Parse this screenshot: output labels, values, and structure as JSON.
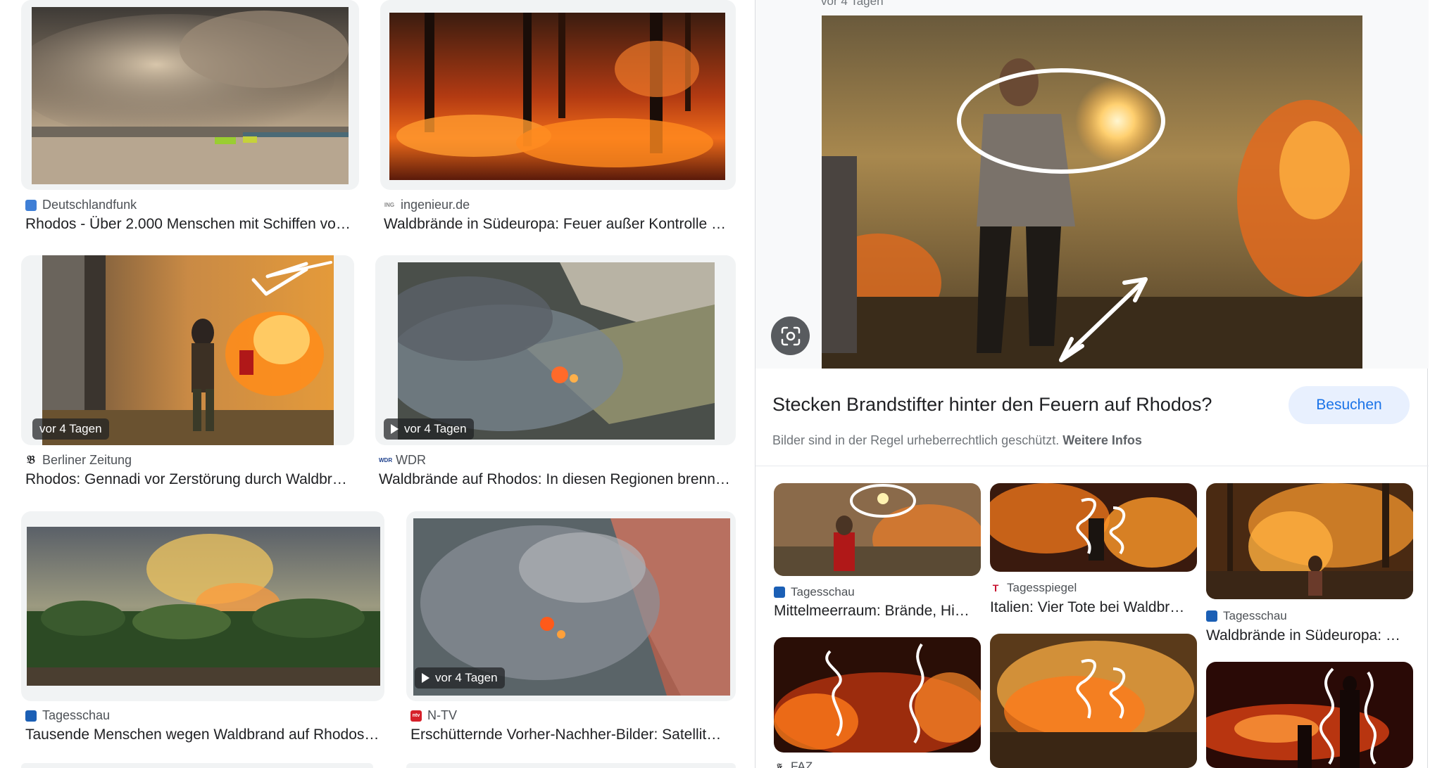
{
  "results": [
    {
      "source": "Deutschlandfunk",
      "caption": "Rhodos - Über 2.000 Menschen mit Schiffen vo…",
      "badge": ""
    },
    {
      "source": "ingenieur.de",
      "caption": "Waldbrände in Südeuropa: Feuer außer Kontrolle …",
      "badge": ""
    },
    {
      "source": "Berliner Zeitung",
      "caption": "Rhodos: Gennadi vor Zerstörung durch Waldbr…",
      "badge": "vor 4 Tagen"
    },
    {
      "source": "WDR",
      "caption": "Waldbrände auf Rhodos: In diesen Regionen brenn…",
      "badge": "vor 4 Tagen"
    },
    {
      "source": "Tagesschau",
      "caption": "Tausende Menschen wegen Waldbrand auf Rhodos…",
      "badge": ""
    },
    {
      "source": "N-TV",
      "caption": "Erschütternde Vorher-Nachher-Bilder: Satellit…",
      "badge": "vor 4 Tagen"
    }
  ],
  "panel": {
    "top_meta": "vor 4 Tagen",
    "title": "Stecken Brandstifter hinter den Feuern auf Rhodos?",
    "visit_label": "Besuchen",
    "copyright_text": "Bilder sind in der Regel urheberrechtlich geschützt.",
    "copyright_link": "Weitere Infos",
    "related": [
      {
        "source": "Tagesschau",
        "caption": "Mittelmeerraum: Brände, Hi…"
      },
      {
        "source": "Tagesspiegel",
        "caption": "Italien: Vier Tote bei Waldbr…"
      },
      {
        "source": "Tagesschau",
        "caption": "Waldbrände in Südeuropa: …"
      },
      {
        "source": "FAZ",
        "caption": ""
      }
    ]
  },
  "colors": {
    "accent": "#1a73e8",
    "visit_bg": "#e8f0fe",
    "text": "#202124",
    "muted": "#70757a"
  }
}
